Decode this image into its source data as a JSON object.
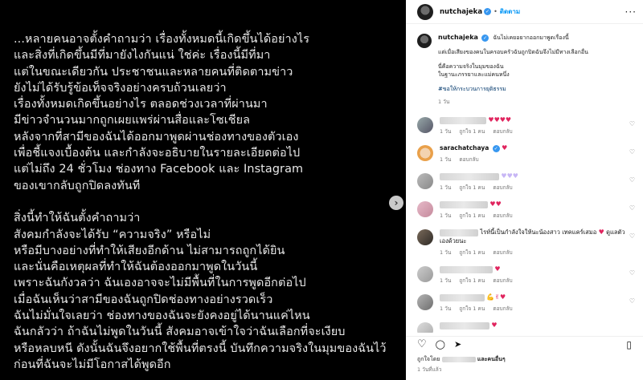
{
  "post": {
    "text": "...หลายคนอาจตั้งคำถามว่า เรื่องทั้งหมดนี้เกิดขึ้นได้อย่างไร\nและสิ่งที่เกิดขึ้นมีที่มายังไงกันแน่ ใช่ค่ะ เรื่องนี้มีที่มา\nแต่ในขณะเดียวกัน ประชาชนและหลายคนที่ติดตามข่าว\nยังไม่ได้รับรู้ข้อเท็จจริงอย่างครบถ้วนเลยว่า\nเรื่องทั้งหมดเกิดขึ้นอย่างไร ตลอดช่วงเวลาที่ผ่านมา\nมีข่าวจำนวนมากถูกเผยแพร่ผ่านสื่อและโซเชียล\nหลังจากที่สามีของฉันได้ออกมาพูดผ่านช่องทางของตัวเอง\nเพื่อชี้แจงเบื้องต้น และกำลังจะอธิบายในรายละเอียดต่อไป\nแต่ไม่ถึง 24 ชั่วโมง ช่องทาง Facebook และ Instagram\nของเขากลับถูกปิดลงทันที\n\nสิ่งนี้ทำให้ฉันตั้งคำถามว่า\nสังคมกำลังจะได้รับ “ความจริง” หรือไม่\nหรือมีบางอย่างที่ทำให้เสียงอีกด้าน ไม่สามารถถูกได้ยิน\nและนั่นคือเหตุผลที่ทำให้ฉันต้องออกมาพูดในวันนี้\nเพราะฉันกังวลว่า ฉันเองอาจจะไม่มีพื้นที่ในการพูดอีกต่อไป\nเมื่อฉันเห็นว่าสามีของฉันถูกปิดช่องทางอย่างรวดเร็ว\nฉันไม่มั่นใจเลยว่า ช่องทางของฉันจะยังคงอยู่ได้นานแค่ไหน\nฉันกลัวว่า ถ้าฉันไม่พูดในวันนี้ สังคมอาจเข้าใจว่าฉันเลือกที่จะเงียบ\nหรือหลบหนี ดังนั้นฉันจึงอยากใช้พื้นที่ตรงนี้ บันทึกความจริงในมุมของฉันไว้\nก่อนที่ฉันจะไม่มีโอกาสได้พูดอีก",
    "next_arrow": "›"
  },
  "header": {
    "username": "nutchajeka",
    "verified_mark": "✓",
    "separator": "•",
    "follow_label": "ติดตาม",
    "more_label": "···"
  },
  "caption": {
    "username": "nutchajeka",
    "lines": [
      "ฉันไม่เคยอยากออกมาพูดเรื่องนี้",
      "แต่เมื่อเสียงของคนในครอบครัวฉันถูกปิดฉันจึงไม่มีทางเลือกอื่น",
      "นี่คือความจริงในมุมของฉัน",
      "ในฐานะภรรยาและแม่คนหนึ่ง"
    ],
    "hashtag": "#ขอให้กระบวนการยุติธรรม",
    "time": "1 วัน"
  },
  "comments": [
    {
      "text": "",
      "emoji": "♥♥♥♥",
      "emoji_color": "h",
      "time": "1 วัน",
      "likes": "ถูกใจ 1 คน",
      "reply": "ตอบกลับ"
    },
    {
      "username": "sarachatchaya",
      "verified_mark": "✓",
      "emoji": "♥",
      "emoji_color": "h",
      "time": "1 วัน",
      "reply": "ตอบกลับ"
    },
    {
      "text": "",
      "emoji": "♥♥♥",
      "emoji_color": "w",
      "time": "1 วัน",
      "likes": "ถูกใจ 1 คน",
      "reply": "ตอบกลับ"
    },
    {
      "text": "",
      "emoji": "♥♥",
      "emoji_color": "h",
      "time": "1 วัน",
      "likes": "ถูกใจ 1 คน",
      "reply": "ตอบกลับ"
    },
    {
      "text": "ไรท์นี้เป็นกำลังใจให้นะน้องสาว เทคแคร์เสมอ",
      "text2": "ดูแลตัวเองด้วยนะ",
      "emoji": "♥",
      "emoji_color": "h",
      "time": "1 วัน",
      "likes": "ถูกใจ 1 คน",
      "reply": "ตอบกลับ"
    },
    {
      "text": "",
      "emoji": "♥",
      "emoji_color": "h",
      "time": "1 วัน",
      "likes": "ถูกใจ 1 คน",
      "reply": "ตอบกลับ"
    },
    {
      "text": "",
      "emoji": "💪✌♥",
      "emoji_color": "h",
      "time": "1 วัน",
      "likes": "ถูกใจ 1 คน",
      "reply": "ตอบกลับ"
    },
    {
      "text": "",
      "emoji": "♥",
      "emoji_color": "h",
      "time": "",
      "likes": "",
      "reply": ""
    }
  ],
  "actions": {
    "like_icon": "♡",
    "comment_icon": "◯",
    "share_icon": "➤",
    "save_icon": "▯"
  },
  "likes_line": {
    "prefix": "ถูกใจโดย",
    "suffix": "และคนอื่นๆ"
  },
  "posted_time": "1 วันที่แล้ว",
  "comment_like_icon": "♡"
}
